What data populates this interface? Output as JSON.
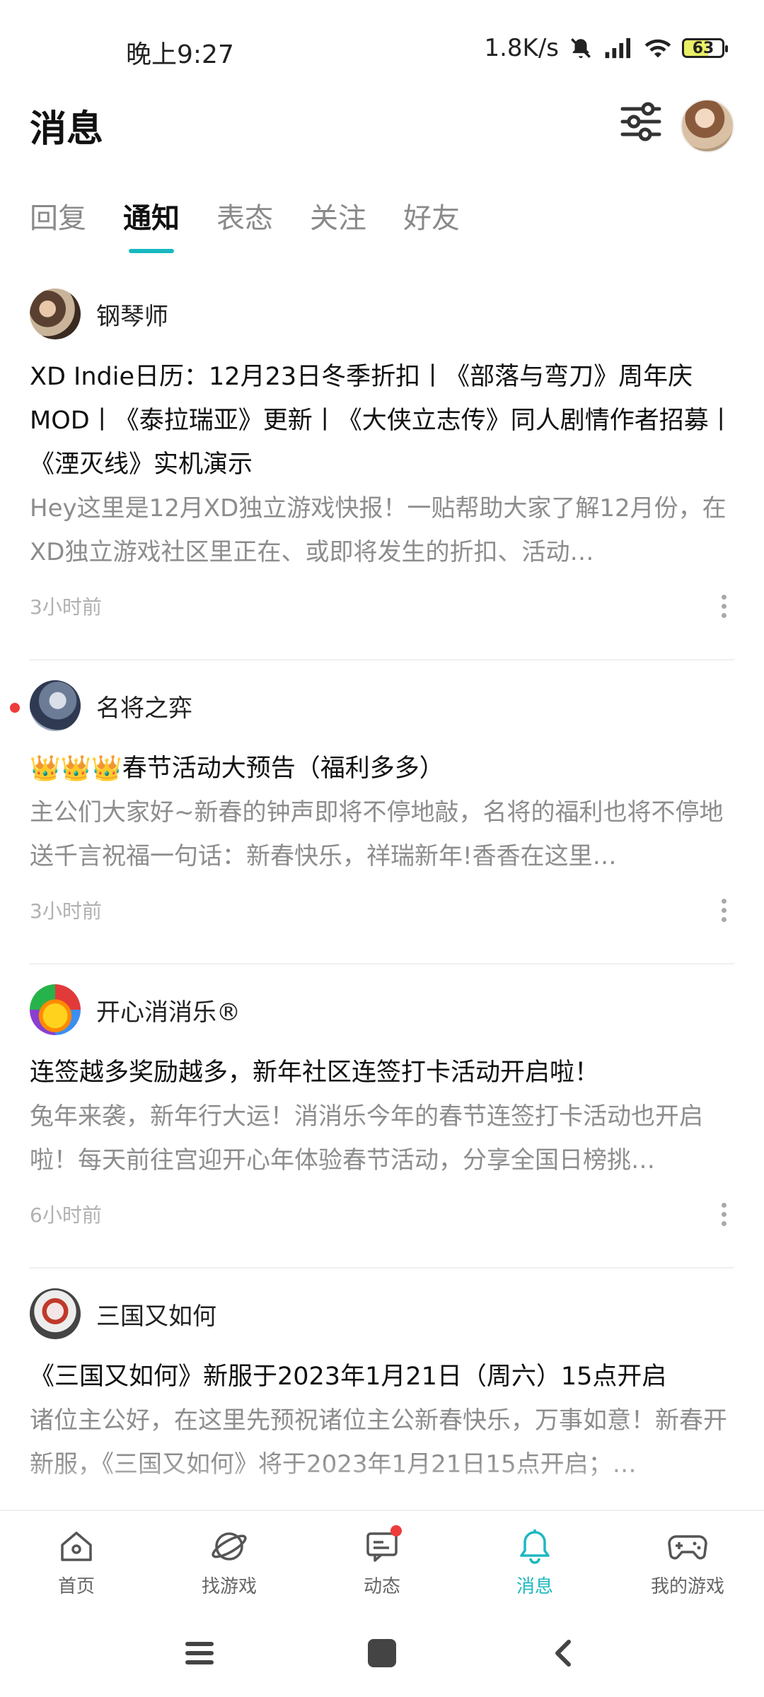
{
  "status_bar": {
    "time": "晚上9:27",
    "speed": "1.8K/s",
    "battery": "63"
  },
  "header": {
    "title": "消息"
  },
  "tabs": [
    {
      "label": "回复",
      "active": false
    },
    {
      "label": "通知",
      "active": true
    },
    {
      "label": "表态",
      "active": false
    },
    {
      "label": "关注",
      "active": false
    },
    {
      "label": "好友",
      "active": false
    }
  ],
  "items": [
    {
      "sender": "钢琴师",
      "title": "XD Indie日历：12月23日冬季折扣丨《部落与弯刀》周年庆MOD丨《泰拉瑞亚》更新丨《大侠立志传》同人剧情作者招募丨《湮灭线》实机演示",
      "body": "Hey这里是12月XD独立游戏快报！一贴帮助大家了解12月份，在XD独立游戏社区里正在、或即将发生的折扣、活动…",
      "time": "3小时前",
      "unread": false
    },
    {
      "sender": "名将之弈",
      "title_icons": "👑👑👑",
      "title": "春节活动大预告（福利多多）",
      "body": "主公们大家好~新春的钟声即将不停地敲，名将的福利也将不停地送千言祝福一句话：新春快乐，祥瑞新年!香香在这里…",
      "time": "3小时前",
      "unread": true
    },
    {
      "sender": "开心消消乐®",
      "title": "连签越多奖励越多，新年社区连签打卡活动开启啦！",
      "body": "兔年来袭，新年行大运！消消乐今年的春节连签打卡活动也开启啦！每天前往宫迎开心年体验春节活动，分享全国日榜挑…",
      "time": "6小时前",
      "unread": false
    },
    {
      "sender": "三国又如何",
      "title": "《三国又如何》新服于2023年1月21日（周六）15点开启",
      "body": "诸位主公好，在这里先预祝诸位主公新春快乐，万事如意！新春开新服，《三国又如何》将于2023年1月21日15点开启；…",
      "time": "",
      "unread": false
    }
  ],
  "bottom_nav": [
    {
      "label": "首页",
      "icon": "home-icon",
      "active": false
    },
    {
      "label": "找游戏",
      "icon": "discover-icon",
      "active": false
    },
    {
      "label": "动态",
      "icon": "feed-icon",
      "active": false,
      "badge": true
    },
    {
      "label": "消息",
      "icon": "bell-icon",
      "active": true
    },
    {
      "label": "我的游戏",
      "icon": "gamepad-icon",
      "active": false
    }
  ],
  "colors": {
    "accent": "#1fb8c1",
    "unread_dot": "#ee3b3b"
  }
}
